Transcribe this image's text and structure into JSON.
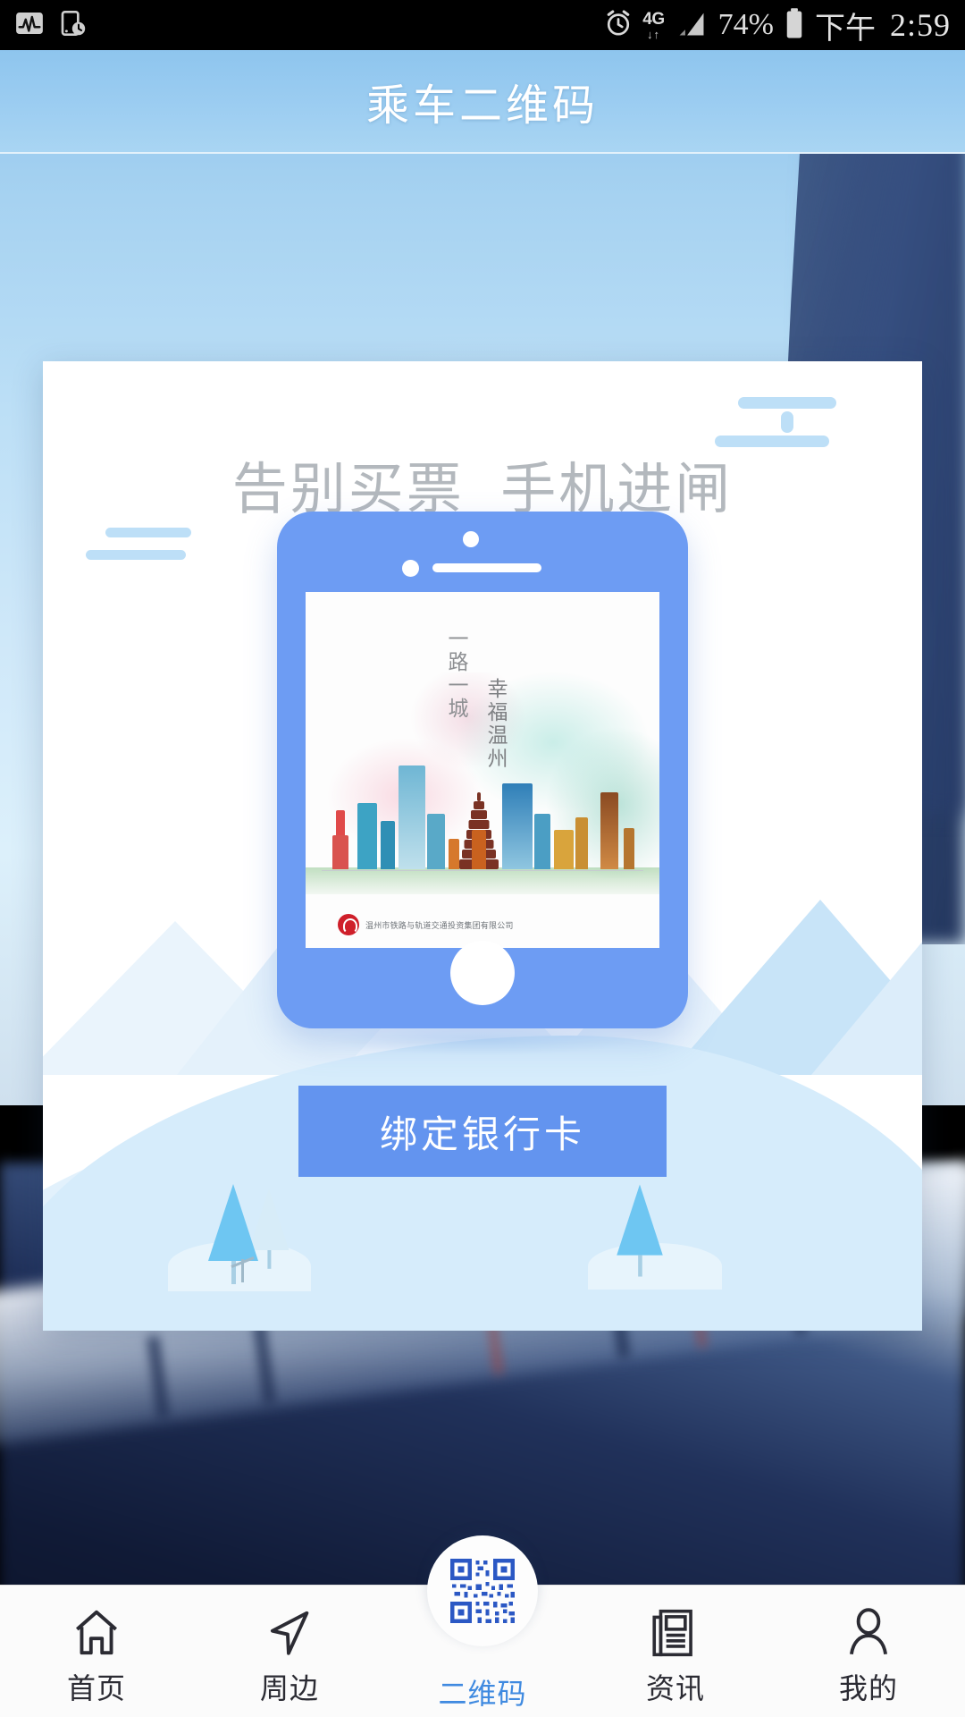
{
  "statusbar": {
    "icons_left": [
      "activity-chart-icon",
      "screen-timer-icon"
    ],
    "alarm_icon": "alarm-clock-icon",
    "network_label": "4G",
    "network_arrows": "↓↑",
    "signal_icon": "signal-bars-icon",
    "battery_percent": "74%",
    "battery_icon": "battery-icon",
    "am_pm": "下午",
    "time": "2:59"
  },
  "header": {
    "title": "乘车二维码"
  },
  "card": {
    "headline": "告别买票  手机进闸",
    "poster": {
      "line_right": "一路一城",
      "line_left": "幸福温州",
      "company": "温州市铁路与轨道交通投资集团有限公司"
    },
    "cta_label": "绑定银行卡"
  },
  "tabbar": {
    "items": [
      {
        "label": "首页",
        "icon": "home-icon",
        "active": false
      },
      {
        "label": "周边",
        "icon": "navigation-arrow-icon",
        "active": false
      },
      {
        "label": "二维码",
        "icon": "qr-code-icon",
        "active": true
      },
      {
        "label": "资讯",
        "icon": "newspaper-icon",
        "active": false
      },
      {
        "label": "我的",
        "icon": "person-icon",
        "active": false
      }
    ]
  },
  "colors": {
    "header_blue": "#9ccdf1",
    "cta_blue": "#6394ef",
    "phone_blue": "#6d9cf3",
    "active_tab": "#3f8ae0",
    "logo_red": "#cf1f2a"
  }
}
